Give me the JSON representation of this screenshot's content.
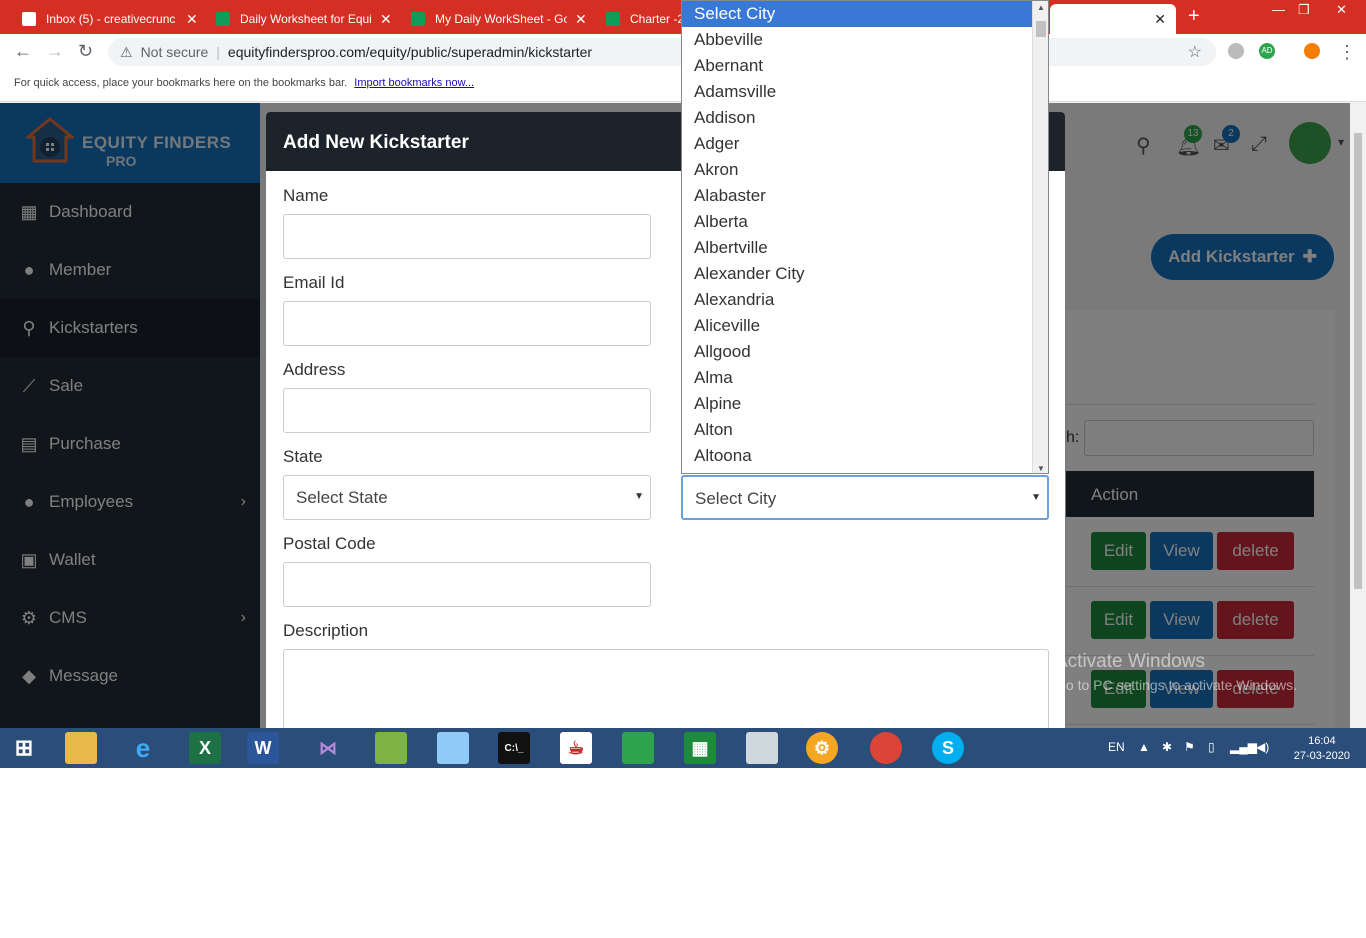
{
  "browser": {
    "tabs": [
      {
        "title": "Inbox (5) - creativecrunc",
        "favicon_color": "#ffffff"
      },
      {
        "title": "Daily Worksheet for Equi",
        "favicon_color": "#0f9d58"
      },
      {
        "title": "My Daily WorkSheet - Go",
        "favicon_color": "#0f9d58"
      },
      {
        "title": "Charter -2",
        "favicon_color": "#0f9d58"
      }
    ],
    "not_secure": "Not secure",
    "url": "equityfindersproo.com/equity/public/superadmin/kickstarter",
    "bookmarks_hint": "For quick access, place your bookmarks here on the bookmarks bar.",
    "bookmarks_link": "Import bookmarks now...",
    "ext_badge": "AD"
  },
  "brand": {
    "name": "EQUITY FINDERS",
    "sub": "PRO"
  },
  "sidebar": {
    "items": [
      {
        "label": "Dashboard",
        "icon": "dashboard-icon"
      },
      {
        "label": "Member",
        "icon": "user-icon"
      },
      {
        "label": "Kickstarters",
        "icon": "search-icon"
      },
      {
        "label": "Sale",
        "icon": "chart-icon"
      },
      {
        "label": "Purchase",
        "icon": "bag-icon"
      },
      {
        "label": "Employees",
        "icon": "users-icon"
      },
      {
        "label": "Wallet",
        "icon": "wallet-icon"
      },
      {
        "label": "CMS",
        "icon": "gear-icon"
      },
      {
        "label": "Message",
        "icon": "chat-icon"
      }
    ]
  },
  "topbar": {
    "notifications": "13",
    "messages": "2"
  },
  "main": {
    "add_button": "Add Kickstarter",
    "search_label": "h:",
    "action_header": "Action",
    "edit": "Edit",
    "view": "View",
    "delete": "delete"
  },
  "modal": {
    "title": "Add New Kickstarter",
    "name_label": "Name",
    "email_label": "Email Id",
    "address_label": "Address",
    "state_label": "State",
    "state_value": "Select State",
    "city_value": "Select City",
    "postal_label": "Postal Code",
    "description_label": "Description"
  },
  "city_options": [
    "Select City",
    "Abbeville",
    "Abernant",
    "Adamsville",
    "Addison",
    "Adger",
    "Akron",
    "Alabaster",
    "Alberta",
    "Albertville",
    "Alexander City",
    "Alexandria",
    "Aliceville",
    "Allgood",
    "Alma",
    "Alpine",
    "Alton",
    "Altoona"
  ],
  "watermark": {
    "line1": "Activate Windows",
    "line2": "Go to PC settings to activate Windows."
  },
  "taskbar": {
    "lang": "EN",
    "time": "16:04",
    "date": "27-03-2020"
  },
  "colors": {
    "brand_blue": "#1570be",
    "sidebar": "#232c35",
    "edit": "#1e8a3c",
    "delete": "#c8283a"
  }
}
